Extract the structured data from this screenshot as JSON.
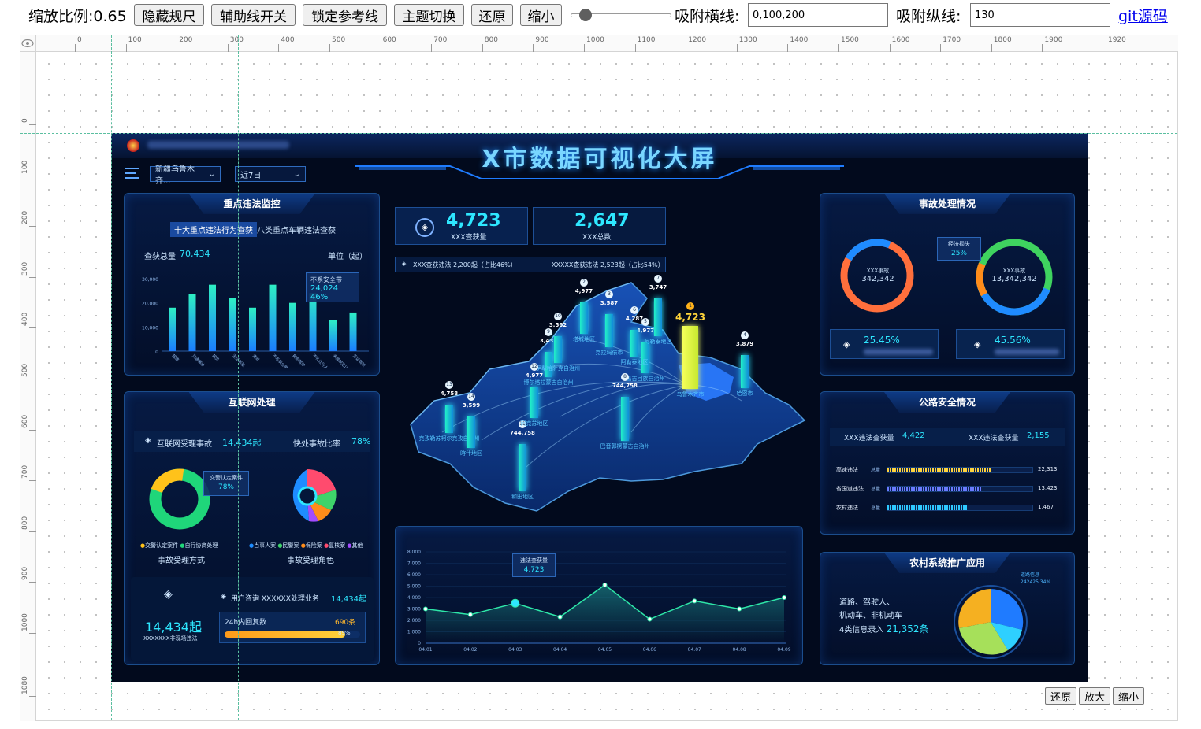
{
  "toolbar": {
    "scale_label": "缩放比例:0.65",
    "btn_hide_ruler": "隐藏规尺",
    "btn_guides": "辅助线开关",
    "btn_lock": "锁定参考线",
    "btn_theme": "主题切换",
    "btn_reset": "还原",
    "btn_shrink": "缩小",
    "slider_value": 0.1,
    "snap_h_label": "吸附横线:",
    "snap_h_value": "0,100,200",
    "snap_v_label": "吸附纵线:",
    "snap_v_value": "130",
    "git_link": "git源码"
  },
  "rulers": {
    "h_labels": [
      "0",
      "100",
      "200",
      "300",
      "400",
      "500",
      "600",
      "700",
      "800",
      "900",
      "1000",
      "1100",
      "1200",
      "1300",
      "1400",
      "1500",
      "1600",
      "1700",
      "1800",
      "1900",
      "1920"
    ],
    "v_labels": [
      "0",
      "100",
      "200",
      "300",
      "400",
      "500",
      "600",
      "700",
      "800",
      "900",
      "1000",
      "1080"
    ]
  },
  "bottom_controls": {
    "reset": "还原",
    "zoom_in": "放大",
    "zoom_out": "缩小"
  },
  "screen": {
    "title": "X市数据可视化大屏",
    "region_select": "新疆乌鲁木齐...",
    "range_select": "近7日",
    "left_top": {
      "title": "重点违法监控",
      "tab_active": "十大重点违法行为查获",
      "tab_other": "八类重点车辆违法查获",
      "total_label": "查获总量",
      "total_value": "70,434",
      "unit_label": "单位（起）",
      "y_ticks": [
        "30,000",
        "20,000",
        "10,000",
        "0"
      ],
      "tooltip_title": "不系安全带",
      "tooltip_value": "24,024",
      "tooltip_pct": "46%",
      "bar_labels": [
        "超速",
        "交通事故",
        "超员",
        "无证驾驶",
        "酒驾",
        "不系安全带",
        "疲劳驾驶",
        "不礼让行人",
        "未按规定让行",
        "无证驾驶"
      ],
      "bar_values": [
        18000,
        23500,
        27500,
        22000,
        18000,
        27500,
        20000,
        24024,
        13000,
        16000
      ]
    },
    "left_mid": {
      "title": "互联网处理",
      "accept_label": "互联网受理事故",
      "accept_value": "14,434起",
      "fast_label": "快处事故比率",
      "fast_value": "78%",
      "donut_tip_label": "交警认定案件",
      "donut_tip_value": "78%",
      "legend1": [
        "交警认定案件",
        "自行协商处理"
      ],
      "legend2": [
        "当事人案",
        "民警案",
        "保险案",
        "复核案",
        "其他"
      ],
      "caption1": "事故受理方式",
      "caption2": "事故受理角色",
      "consult_label": "用户咨询 XXXXXX处理业务",
      "consult_value": "14,434起",
      "big_value": "14,434起",
      "big_caption": "XXXXXXX非现场违法",
      "reply_label": "24h内回复数",
      "reply_value": "690条",
      "reply_pct": "89%",
      "reply_fraction": 0.89
    },
    "center": {
      "kpi1_value": "4,723",
      "kpi1_label": "XXX查获量",
      "kpi2_value": "2,647",
      "kpi2_label": "XXX总数",
      "sub1": "XXX查获违法 2,200起（占比46%）",
      "sub2": "XXXXX查获违法 2,523起（占比54%）",
      "map_points": [
        {
          "rank": "1",
          "value": "4,723",
          "name": "乌鲁木齐市"
        },
        {
          "rank": "2",
          "value": "4,977",
          "name": "塔城地区"
        },
        {
          "rank": "3",
          "value": "3,587",
          "name": "克拉玛依市"
        },
        {
          "rank": "4",
          "value": "3,879",
          "name": "哈密市"
        },
        {
          "rank": "5",
          "value": "4,977",
          "name": "昌吉回族自治州"
        },
        {
          "rank": "6",
          "value": "4,287",
          "name": "阿勒泰地区"
        },
        {
          "rank": "7",
          "value": "3,747",
          "name": "阿勒泰地区"
        },
        {
          "rank": "8",
          "value": "744,758",
          "name": "巴音郭楞蒙古自治州"
        },
        {
          "rank": "9",
          "value": "3,432",
          "name": "博尔塔拉蒙古自治州"
        },
        {
          "rank": "10",
          "value": "3,562",
          "name": "伊犁哈萨克自治州"
        },
        {
          "rank": "11",
          "value": "744,758",
          "name": "和田地区"
        },
        {
          "rank": "12",
          "value": "4,977",
          "name": "阿克苏地区"
        },
        {
          "rank": "13",
          "value": "4,758",
          "name": "克孜勒苏柯尔克孜自治州"
        },
        {
          "rank": "14",
          "value": "3,599",
          "name": "喀什地区"
        }
      ]
    },
    "line_chart": {
      "tooltip_title": "违法查获量",
      "tooltip_value": "4,723",
      "x": [
        "04.01",
        "04.02",
        "04.03",
        "04.04",
        "04.05",
        "04.06",
        "04.07",
        "04.08",
        "04.09"
      ],
      "y": [
        3000,
        2500,
        3500,
        2300,
        5100,
        2100,
        3700,
        3000,
        4000
      ],
      "y_ticks": [
        "8,000",
        "7,000",
        "6,000",
        "5,000",
        "4,000",
        "3,000",
        "2,000",
        "1,000",
        "0"
      ]
    },
    "right_top": {
      "title": "事故处理情况",
      "donut1_label": "XXX事故",
      "donut1_value": "342,342",
      "donut2_label": "XXX事故",
      "donut2_value": "13,342,342",
      "tip_label": "经济损失",
      "tip_value": "25%",
      "card1_value": "25.45%",
      "card2_value": "45.56%"
    },
    "right_mid": {
      "title": "公路安全情况",
      "stat1_label": "XXX违法查获量",
      "stat1_value": "4,422",
      "stat2_label": "XXX违法查获量",
      "stat2_value": "2,155",
      "bars": [
        {
          "label": "高速违法",
          "total": "总量",
          "value": "22,313",
          "fraction": 0.72,
          "color": "#ffd33d"
        },
        {
          "label": "省国道违法",
          "total": "总量",
          "value": "13,423",
          "fraction": 0.65,
          "color": "#6a7bff"
        },
        {
          "label": "农村违法",
          "total": "总量",
          "value": "1,467",
          "fraction": 0.55,
          "color": "#2ec9ff"
        }
      ]
    },
    "right_bottom": {
      "title": "农村系统推广应用",
      "line1": "道路、驾驶人、",
      "line2": "机动车、非机动车",
      "line3_prefix": "4类信息录入",
      "line3_value": "21,352条",
      "pie_tip_label": "道路信息",
      "pie_tip_value": "242425  34%"
    }
  }
}
